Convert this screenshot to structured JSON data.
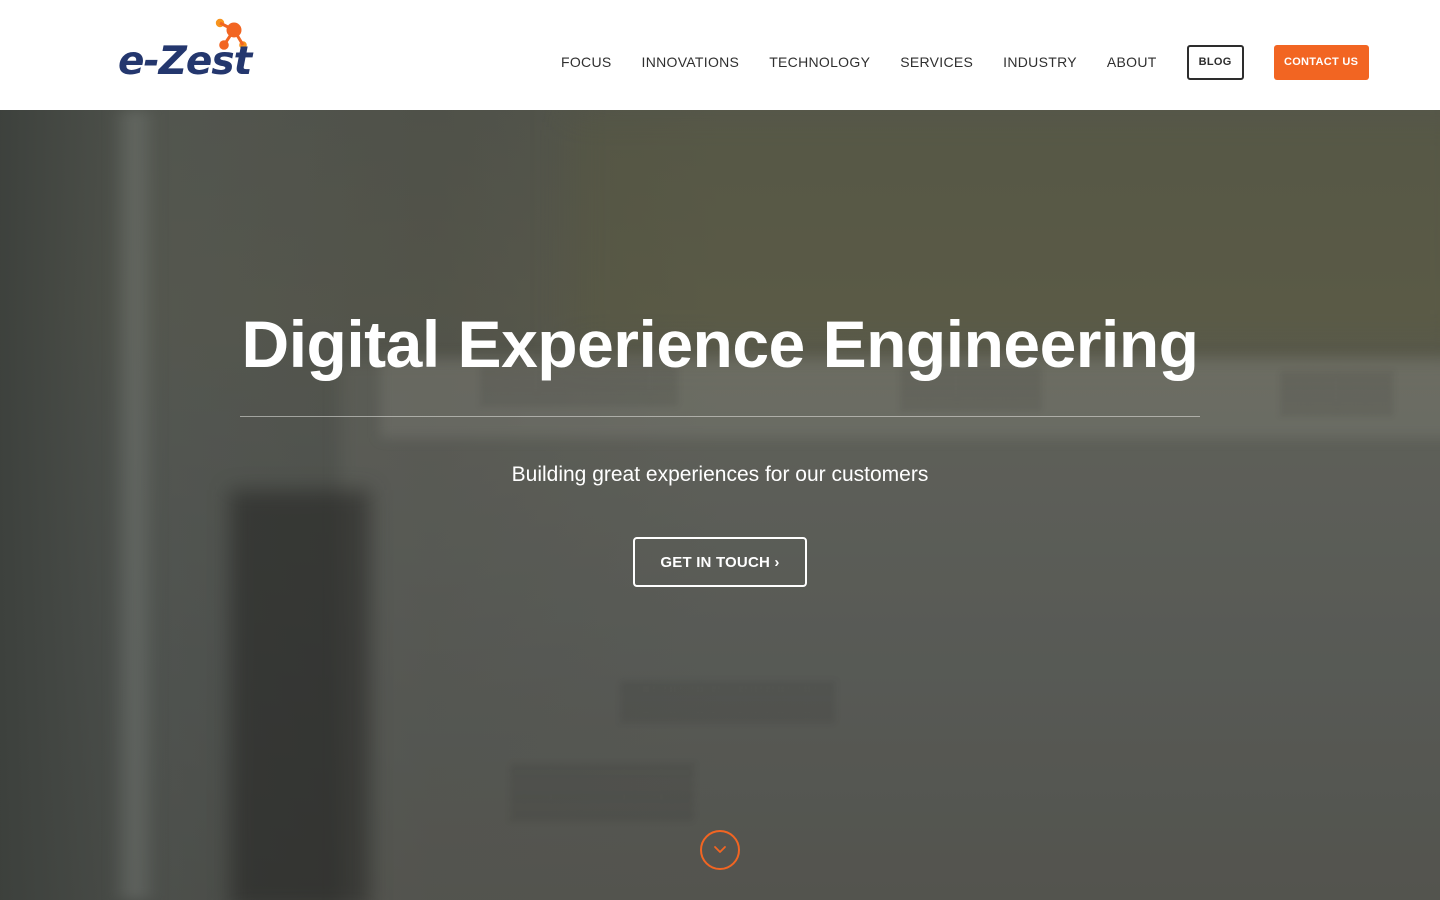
{
  "brand": {
    "logo_text": "e-Zest",
    "logo_text_color": "#24376e",
    "accent_color": "#f26522"
  },
  "nav": {
    "items": [
      {
        "label": "FOCUS"
      },
      {
        "label": "INNOVATIONS"
      },
      {
        "label": "TECHNOLOGY"
      },
      {
        "label": "SERVICES"
      },
      {
        "label": "INDUSTRY"
      },
      {
        "label": "ABOUT"
      }
    ],
    "blog_label": "BLOG",
    "contact_label": "CONTACT US"
  },
  "hero": {
    "title": "Digital Experience Engineering",
    "subtitle": "Building great experiences for our customers",
    "cta_label": "GET IN TOUCH ›",
    "scroll_icon": "chevron-down-icon"
  }
}
